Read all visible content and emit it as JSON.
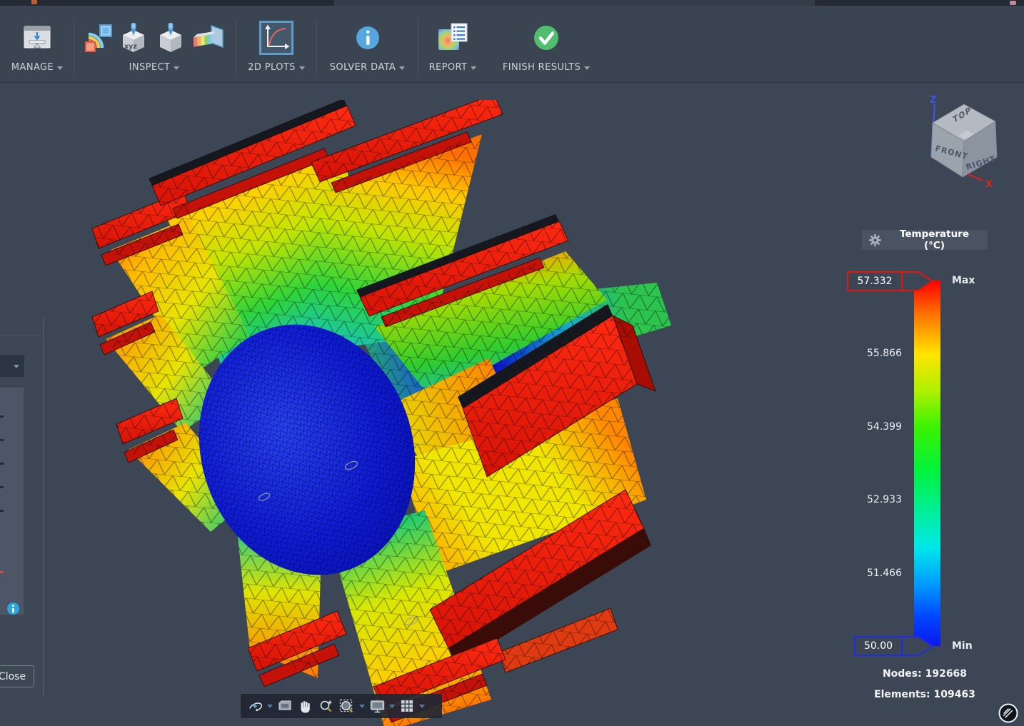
{
  "toolbar": {
    "groups": [
      {
        "label": "MANAGE"
      },
      {
        "label": "INSPECT"
      },
      {
        "label": "2D PLOTS",
        "active": true
      },
      {
        "label": "SOLVER DATA"
      },
      {
        "label": "REPORT"
      },
      {
        "label": "FINISH RESULTS"
      }
    ],
    "probe_text": "xyz"
  },
  "viewcube": {
    "faces": [
      "TOP",
      "FRONT",
      "RIGHT"
    ],
    "axes": {
      "z": "Z",
      "x": "X"
    },
    "z_color": "#3f57e8",
    "x_color": "#cf2a22"
  },
  "legend": {
    "title": "Temperature (°C)",
    "max_label": "Max",
    "min_label": "Min",
    "max_value": "57.332",
    "min_value": "50.00",
    "ticks": [
      "55.866",
      "54.399",
      "52.933",
      "51.466"
    ],
    "max_border_color": "#e81410",
    "min_border_color": "#1e2ce8",
    "colormap": [
      "#ff0000",
      "#ffe400",
      "#3cf200",
      "#00e8e8",
      "#0d18ee"
    ]
  },
  "stats": {
    "nodes": "Nodes: 192668",
    "elements": "Elements: 109463"
  },
  "left_panel": {
    "close_label": "Close"
  },
  "nav_toolbar": {
    "icons": [
      "orbit",
      "look-at",
      "pan",
      "zoom",
      "window-zoom",
      "display-settings",
      "grid"
    ]
  },
  "model": {
    "type": "thermal-fea-mesh",
    "hub_color": "#0a10c0",
    "cap_color": "#e81505"
  }
}
